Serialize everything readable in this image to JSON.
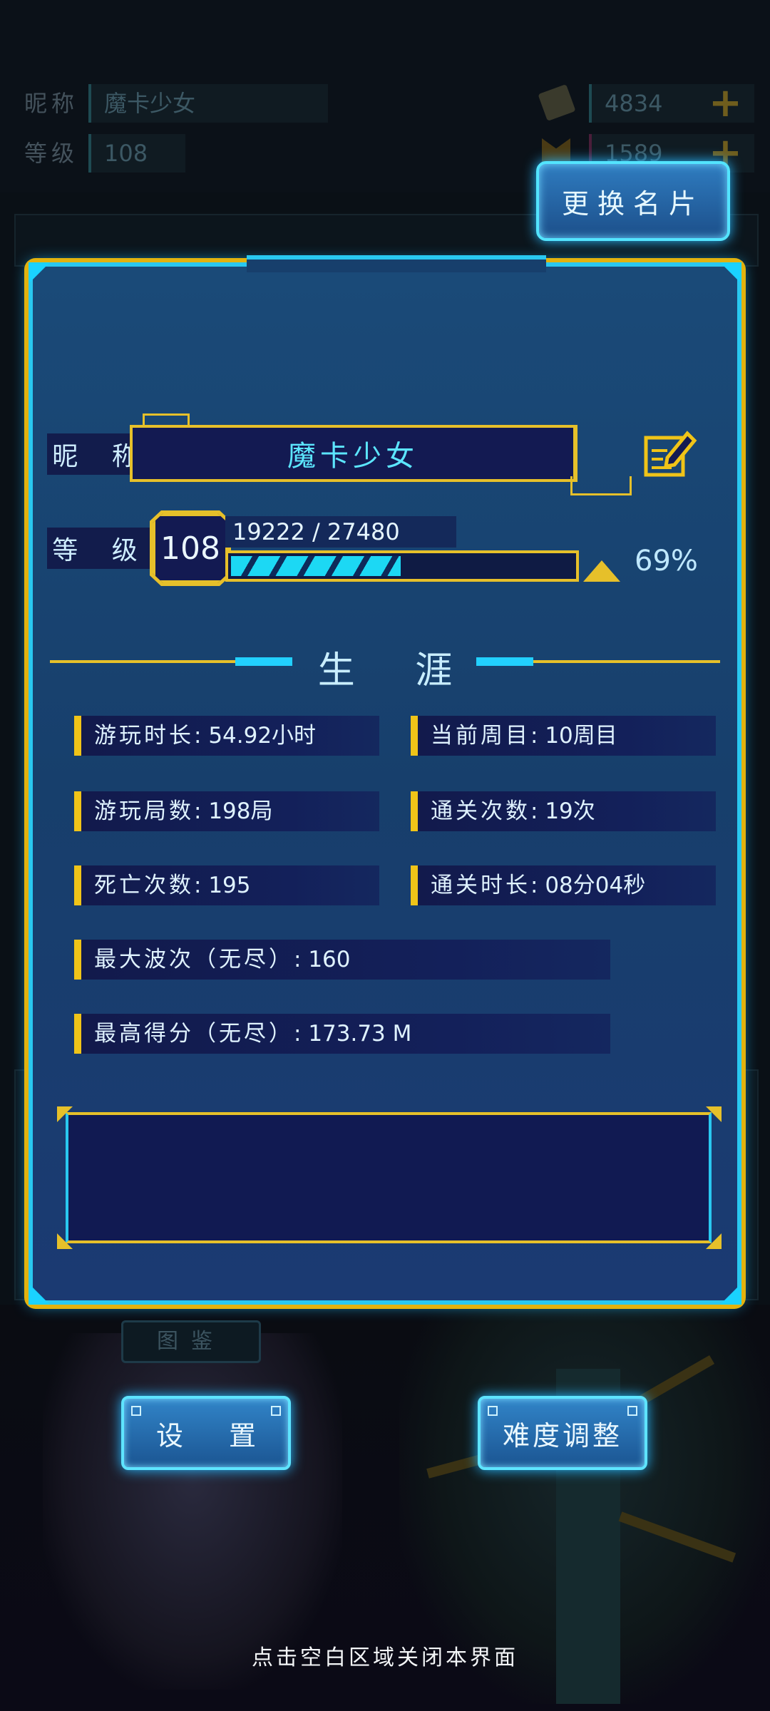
{
  "header": {
    "nickname_label": "昵称",
    "nickname_value": "魔卡少女",
    "level_label": "等级",
    "level_value": "108",
    "currency1_value": "4834",
    "currency2_value": "1589",
    "plus_symbol": "+"
  },
  "change_card_button": "更换名片",
  "profile": {
    "nickname_label": "昵 称",
    "nickname": "魔卡少女",
    "level_label": "等 级",
    "level": "108",
    "xp_text": "19222 / 27480",
    "xp_current": 19222,
    "xp_max": 27480,
    "xp_percent_text": "69%",
    "xp_fraction": 0.69
  },
  "career": {
    "title": "生 涯",
    "stats": [
      {
        "label": "游玩时长",
        "value": "54.92小时"
      },
      {
        "label": "当前周目",
        "value": "10周目"
      },
      {
        "label": "游玩局数",
        "value": "198局"
      },
      {
        "label": "通关次数",
        "value": "19次"
      },
      {
        "label": "死亡次数",
        "value": "195"
      },
      {
        "label": "通关时长",
        "value": "08分04秒"
      },
      {
        "label": "最大波次（无尽）",
        "value": "160"
      },
      {
        "label": "最高得分（无尽）",
        "value": "173.73 M"
      }
    ]
  },
  "background_tag": "图鉴",
  "buttons": {
    "settings": "设 置",
    "difficulty": "难度调整"
  },
  "close_hint": "点击空白区域关闭本界面",
  "colors": {
    "accent_cyan": "#29c8f0",
    "accent_gold": "#e6c02a",
    "panel_blue": "#173f6c"
  }
}
